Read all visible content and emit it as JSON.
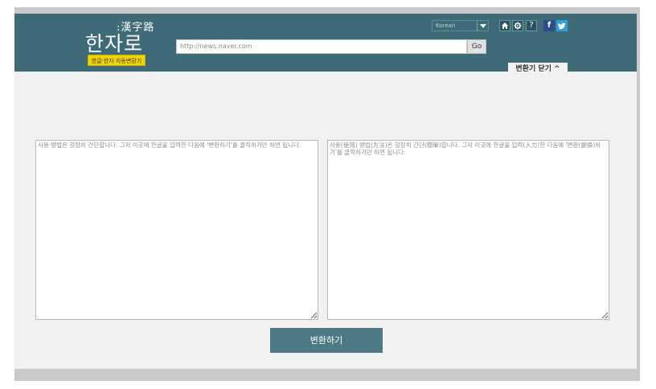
{
  "header": {
    "logo_hanja": ":漢字路",
    "logo_hangul": "한자로",
    "logo_tagline": "한글·한자 자동변환기",
    "url_value": "http://news.naver.com",
    "go_label": "Go",
    "language_selected": "Korean",
    "close_tab_label": "변환기 닫기 ^"
  },
  "icons": {
    "home": "home-icon",
    "settings": "gear-icon",
    "help": "help-icon",
    "facebook": "facebook-icon",
    "twitter": "twitter-icon"
  },
  "input_text": "사용 방법은 굉장히 간단합니다. 그저 이곳에 한글을 입력한 다음에 '변환하기'를 클릭하기만 하면 됩니다.",
  "output_text": "사용(使用) 방법(方法)은 굉장히 간단(簡單)합니다. 그저 이곳에 한글을 입력(入力)한 다음에 '변환(變換)하기'를 클릭하기만 하면 됩니다.",
  "convert_label": "변환하기",
  "colors": {
    "header_bg": "#3f6b79",
    "accent_button": "#4d7985",
    "tag_yellow": "#f1d500"
  }
}
